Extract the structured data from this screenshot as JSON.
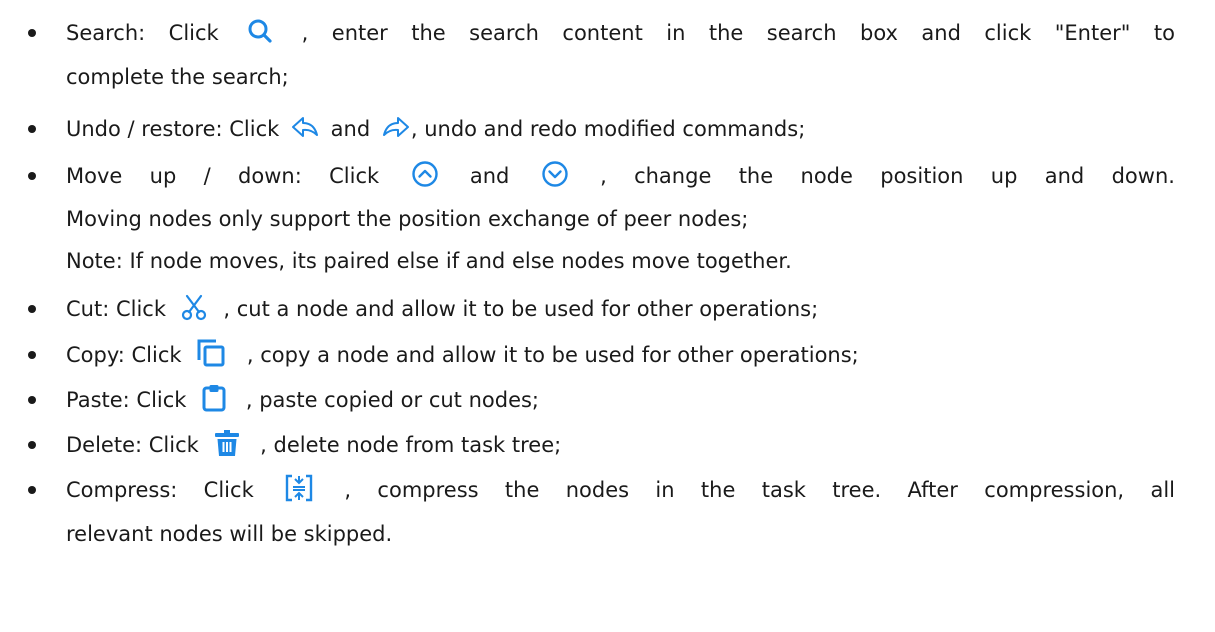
{
  "accent": "#1e88e5",
  "items": {
    "search": {
      "l1_before": "Search: Click",
      "icon": "search-icon",
      "l1_after": ", enter the search content in the search box and click \"Enter\" to",
      "l2": "complete the search;"
    },
    "undo": {
      "before": "Undo / restore: Click",
      "icon1": "undo-icon",
      "mid": "and",
      "icon2": "redo-icon",
      "after": ", undo and redo modified commands;"
    },
    "move": {
      "l1_before": "Move up / down: Click",
      "icon1": "move-up-icon",
      "mid": "and",
      "icon2": "move-down-icon",
      "l1_after": ", change the node position up and down.",
      "l2": "Moving nodes only support the position exchange of peer nodes;",
      "l3": "Note: If node moves, its paired else if and else nodes move together."
    },
    "cut": {
      "before": "Cut: Click",
      "icon": "cut-icon",
      "after": ", cut a node and allow it to be used for other operations;"
    },
    "copy": {
      "before": "Copy: Click",
      "icon": "copy-icon",
      "after": ", copy a node and allow it to be used for other operations;"
    },
    "paste": {
      "before": "Paste: Click",
      "icon": "paste-icon",
      "after": ", paste copied or cut nodes;"
    },
    "delete": {
      "before": "Delete: Click",
      "icon": "delete-icon",
      "after": ", delete node from task tree;"
    },
    "compress": {
      "l1_before": "Compress: Click",
      "icon": "compress-icon",
      "l1_after": ", compress the nodes in the task tree. After compression, all",
      "l2": "relevant nodes will be skipped."
    }
  }
}
